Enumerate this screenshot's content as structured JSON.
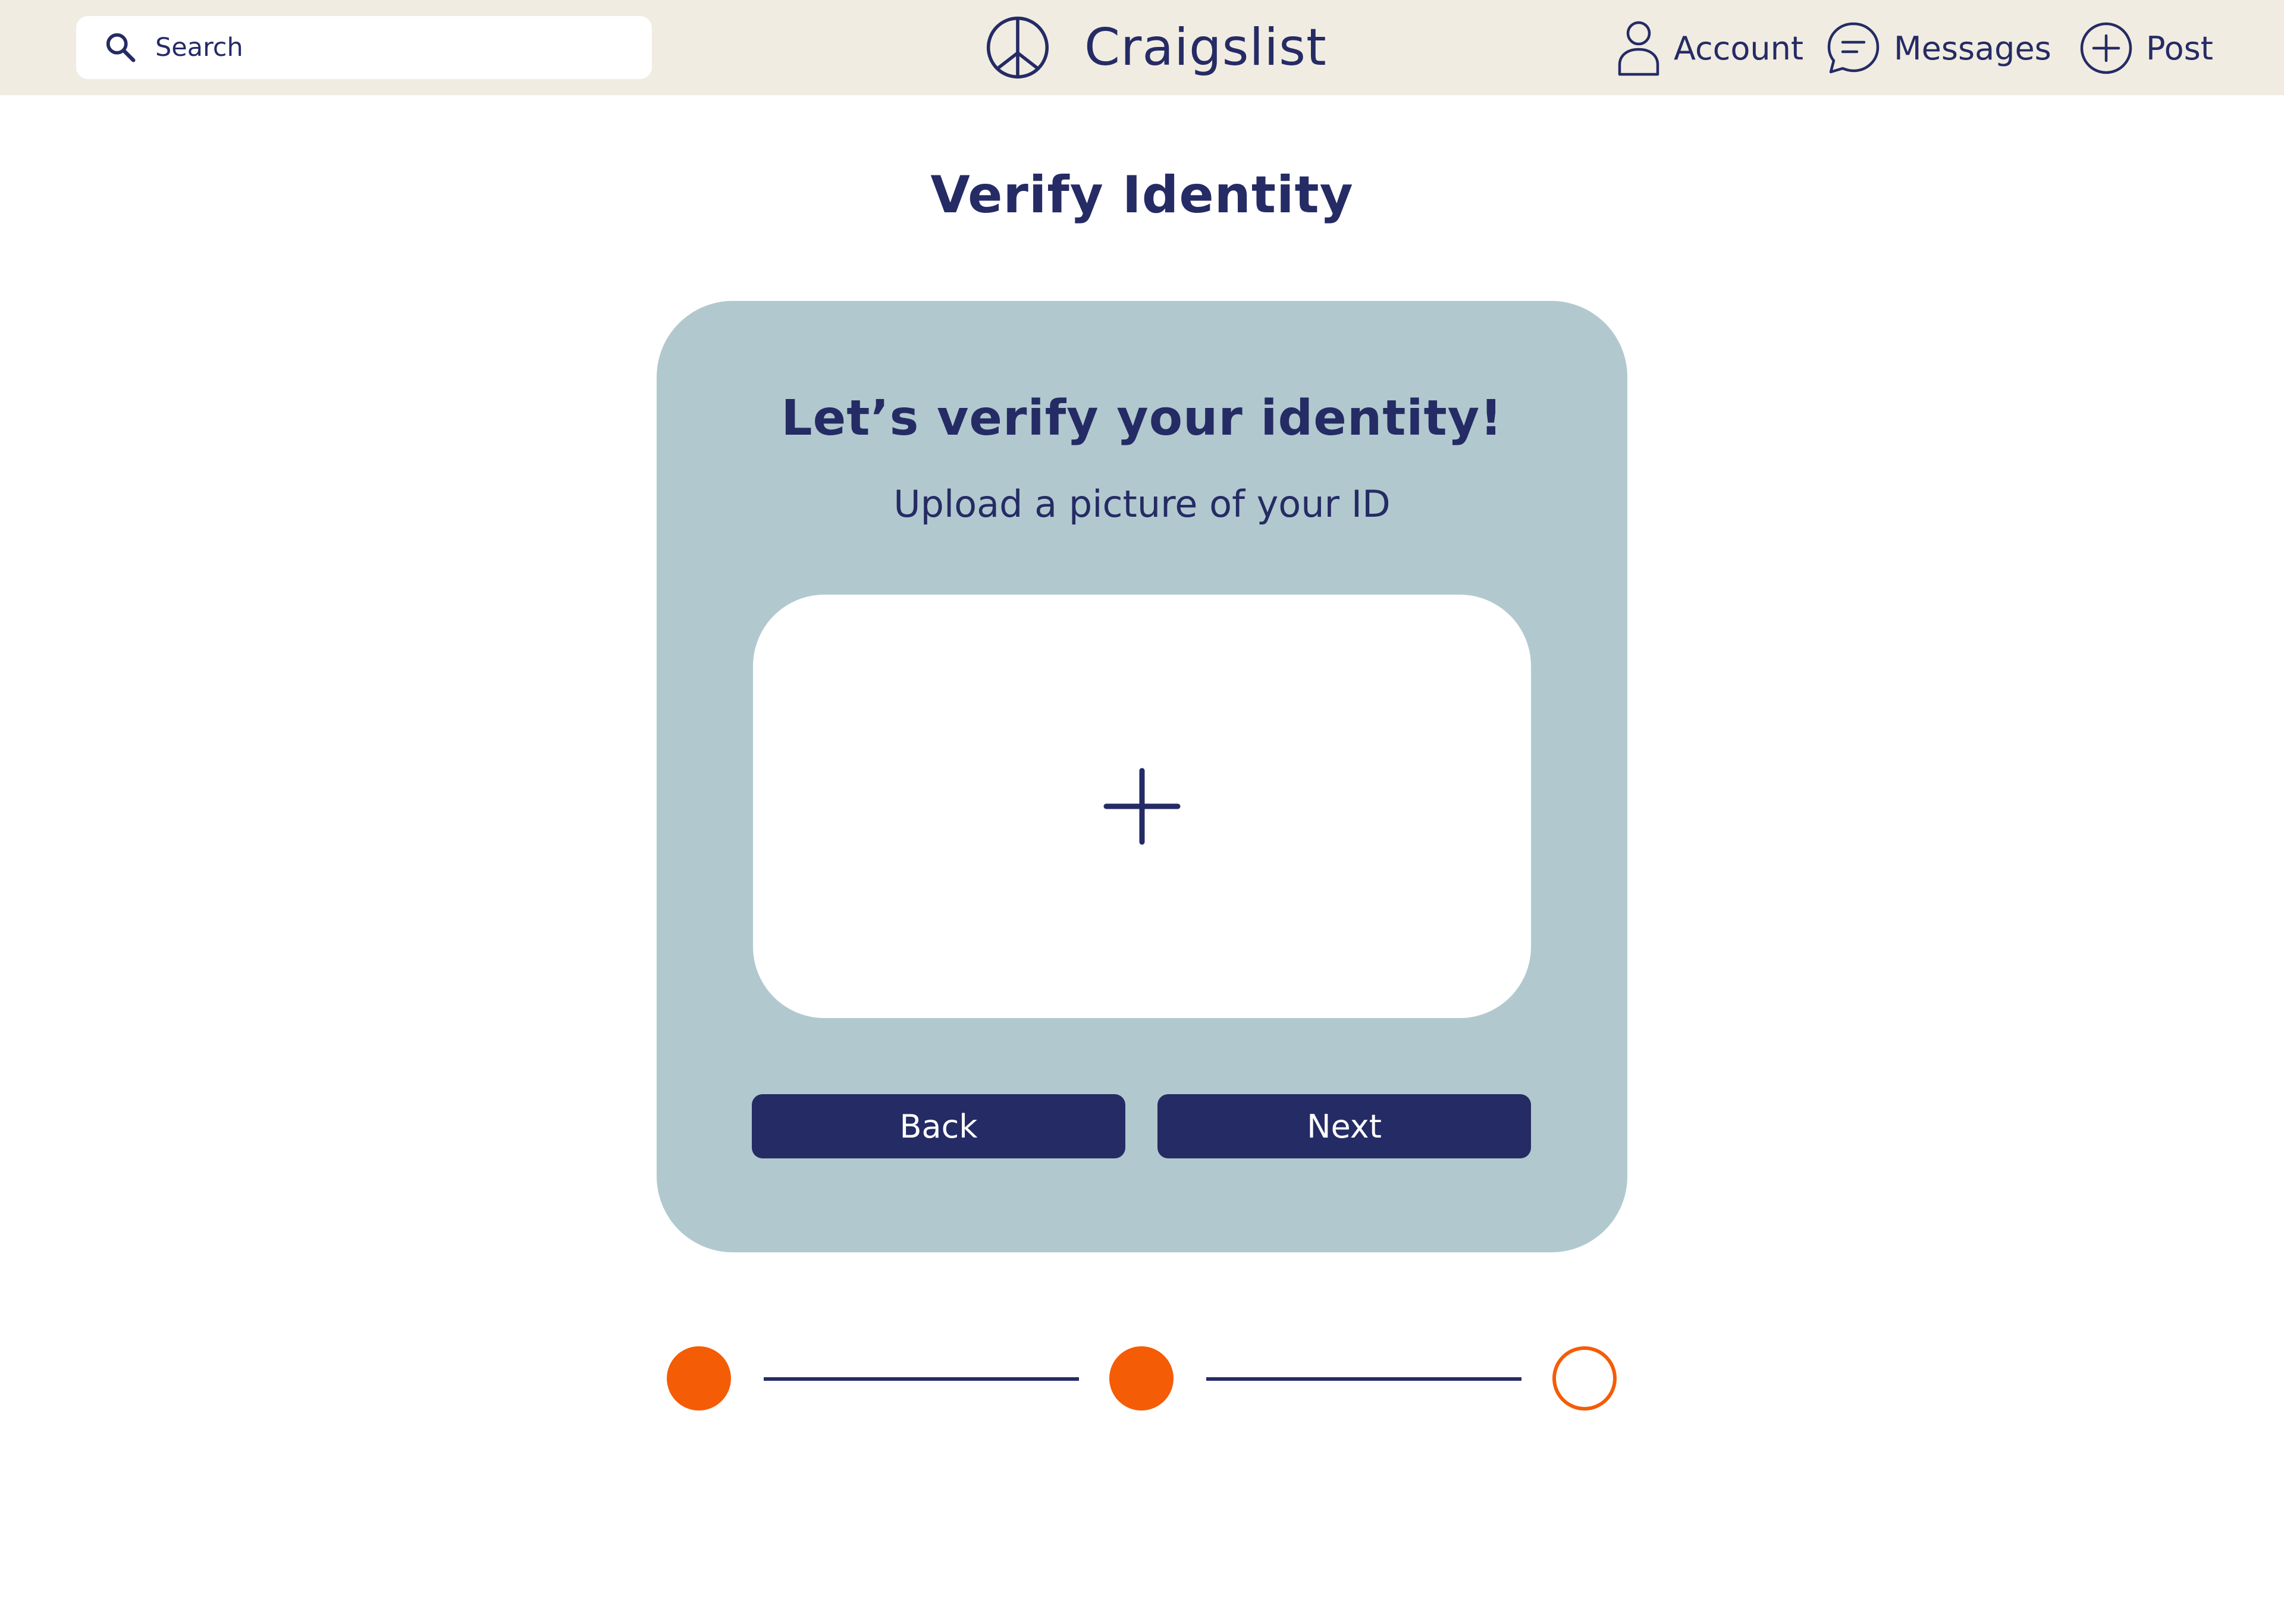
{
  "header": {
    "search": {
      "placeholder": "Search",
      "icon": "search-icon"
    },
    "brand": {
      "name": "Craigslist",
      "logo_icon": "peace-sign-icon"
    },
    "nav": [
      {
        "label": "Account",
        "icon": "user-icon"
      },
      {
        "label": "Messages",
        "icon": "chat-bubble-icon"
      },
      {
        "label": "Post",
        "icon": "plus-circle-icon"
      }
    ]
  },
  "page": {
    "title": "Verify Identity"
  },
  "card": {
    "heading": "Let’s verify your identity!",
    "subheading": "Upload a picture of your ID",
    "upload_icon": "plus-icon",
    "back_label": "Back",
    "next_label": "Next"
  },
  "stepper": {
    "total_steps": 3,
    "completed_steps": 2,
    "steps": [
      {
        "state": "complete"
      },
      {
        "state": "complete"
      },
      {
        "state": "incomplete"
      }
    ]
  },
  "colors": {
    "header_bg": "#f1ece2",
    "navy": "#252b64",
    "card_bg": "#b1c9ce",
    "accent_orange": "#f55c06",
    "white": "#ffffff"
  }
}
